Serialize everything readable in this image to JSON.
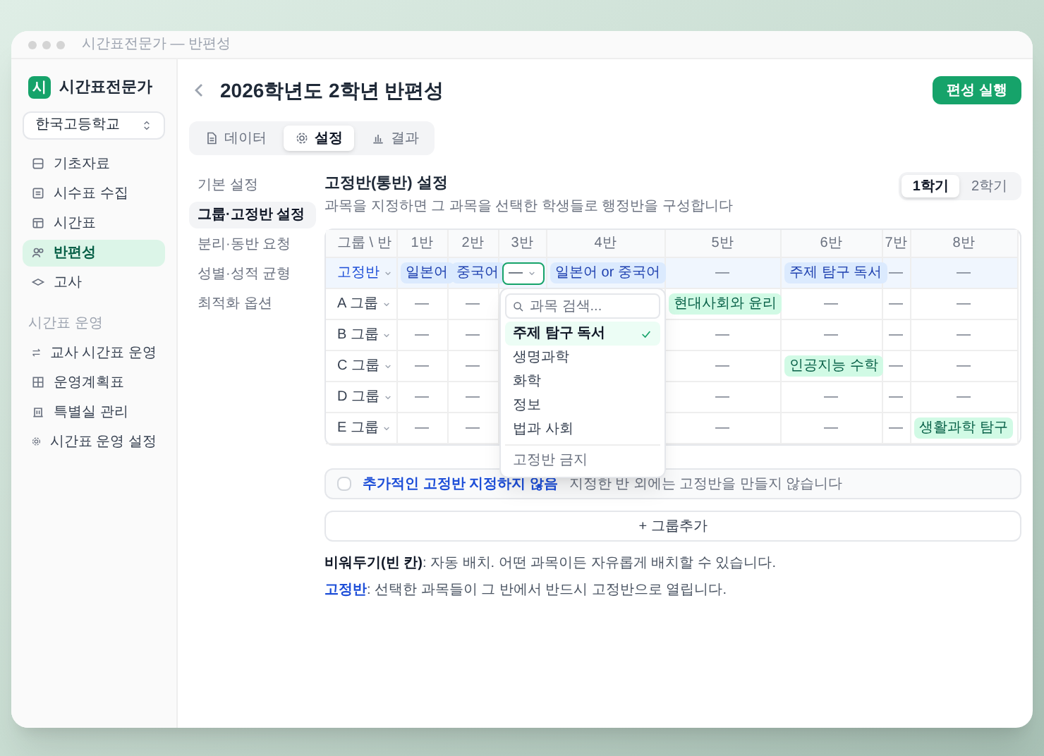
{
  "window": {
    "title": "시간표전문가 — 반편성"
  },
  "sidebar": {
    "app_name": "시간표전문가",
    "logo": "시",
    "school": "한국고등학교",
    "items": [
      {
        "label": "기초자료",
        "selected": false
      },
      {
        "label": "시수표 수집",
        "selected": false
      },
      {
        "label": "시간표",
        "selected": false
      },
      {
        "label": "반편성",
        "selected": true
      },
      {
        "label": "고사",
        "selected": false
      }
    ],
    "section": "시간표 운영",
    "section_items": [
      {
        "label": "교사 시간표 운영",
        "selected": false
      },
      {
        "label": "운영계획표",
        "selected": false
      },
      {
        "label": "특별실 관리",
        "selected": false
      },
      {
        "label": "시간표 운영 설정",
        "selected": false
      }
    ]
  },
  "header": {
    "title": "2026학년도 2학년 반편성",
    "run_button": "편성 실행"
  },
  "tabs": [
    {
      "label": "데이터",
      "selected": false
    },
    {
      "label": "설정",
      "selected": true
    },
    {
      "label": "결과",
      "selected": false
    }
  ],
  "settings_nav": [
    {
      "label": "기본 설정",
      "selected": false
    },
    {
      "label": "그룹·고정반 설정",
      "selected": true
    },
    {
      "label": "분리·동반 요청",
      "selected": false
    },
    {
      "label": "성별·성적 균형",
      "selected": false
    },
    {
      "label": "최적화 옵션",
      "selected": false
    }
  ],
  "section": {
    "title": "고정반(통반) 설정",
    "description": "과목을 지정하면 그 과목을 선택한 학생들로 행정반을 구성합니다",
    "semesters": [
      {
        "label": "1학기",
        "selected": true
      },
      {
        "label": "2학기",
        "selected": false
      }
    ]
  },
  "table": {
    "corner": "그룹 \\ 반",
    "columns": [
      "1반",
      "2반",
      "3반",
      "4반",
      "5반",
      "6반",
      "7반",
      "8반"
    ],
    "rows": [
      {
        "label": "고정반",
        "kind": "fixed",
        "cells": [
          {
            "kind": "pill",
            "text": "일본어"
          },
          {
            "kind": "pill",
            "text": "중국어"
          },
          {
            "kind": "select",
            "text": "—"
          },
          {
            "kind": "pill",
            "text": "일본어 or 중국어"
          },
          {
            "kind": "dash",
            "text": "—"
          },
          {
            "kind": "pill",
            "text": "주제 탐구 독서"
          },
          {
            "kind": "dash",
            "text": "—"
          },
          {
            "kind": "dash",
            "text": "—"
          }
        ]
      },
      {
        "label": "A 그룹",
        "kind": "group",
        "cells": [
          {
            "kind": "dash",
            "text": "—"
          },
          {
            "kind": "dash",
            "text": "—"
          },
          null,
          null,
          {
            "kind": "pill",
            "text": "현대사회와 윤리"
          },
          {
            "kind": "dash",
            "text": "—"
          },
          {
            "kind": "dash",
            "text": "—"
          },
          {
            "kind": "dash",
            "text": "—"
          }
        ]
      },
      {
        "label": "B 그룹",
        "kind": "group",
        "cells": [
          {
            "kind": "dash",
            "text": "—"
          },
          {
            "kind": "dash",
            "text": "—"
          },
          null,
          null,
          {
            "kind": "dash",
            "text": "—"
          },
          {
            "kind": "dash",
            "text": "—"
          },
          {
            "kind": "dash",
            "text": "—"
          },
          {
            "kind": "dash",
            "text": "—"
          }
        ]
      },
      {
        "label": "C 그룹",
        "kind": "group",
        "cells": [
          {
            "kind": "dash",
            "text": "—"
          },
          {
            "kind": "dash",
            "text": "—"
          },
          null,
          null,
          {
            "kind": "dash",
            "text": "—"
          },
          {
            "kind": "pill",
            "text": "인공지능 수학"
          },
          {
            "kind": "dash",
            "text": "—"
          },
          {
            "kind": "dash",
            "text": "—"
          }
        ]
      },
      {
        "label": "D 그룹",
        "kind": "group",
        "cells": [
          {
            "kind": "dash",
            "text": "—"
          },
          {
            "kind": "dash",
            "text": "—"
          },
          null,
          null,
          {
            "kind": "dash",
            "text": "—"
          },
          {
            "kind": "dash",
            "text": "—"
          },
          {
            "kind": "dash",
            "text": "—"
          },
          {
            "kind": "dash",
            "text": "—"
          }
        ]
      },
      {
        "label": "E 그룹",
        "kind": "group",
        "cells": [
          {
            "kind": "dash",
            "text": "—"
          },
          {
            "kind": "dash",
            "text": "—"
          },
          null,
          null,
          {
            "kind": "dash",
            "text": "—"
          },
          {
            "kind": "dash",
            "text": "—"
          },
          {
            "kind": "dash",
            "text": "—"
          },
          {
            "kind": "pill",
            "text": "생활과학 탐구"
          }
        ]
      }
    ]
  },
  "dropdown": {
    "search_placeholder": "과목 검색...",
    "options": [
      {
        "label": "주제 탐구 독서",
        "selected": true
      },
      {
        "label": "생명과학",
        "selected": false
      },
      {
        "label": "화학",
        "selected": false
      },
      {
        "label": "정보",
        "selected": false
      },
      {
        "label": "법과 사회",
        "selected": false
      }
    ],
    "forbid_option": "고정반 금지"
  },
  "no_extra": {
    "checked": false,
    "label": "추가적인 고정반 지정하지 않음",
    "description": "지정한 반 외에는 고정반을 만들지 않습니다"
  },
  "add_group": "+ 그룹추가",
  "notes": [
    {
      "text": "**비워두기(빈 칸)**: 자동 배치. 어떤 과목이든 자유롭게 배치할 수 있습니다.",
      "accent": false
    },
    {
      "text": "**고정반**: 선택한 과목들이 그 반에서 반드시 고정반으로 열립니다.",
      "accent": true
    }
  ]
}
